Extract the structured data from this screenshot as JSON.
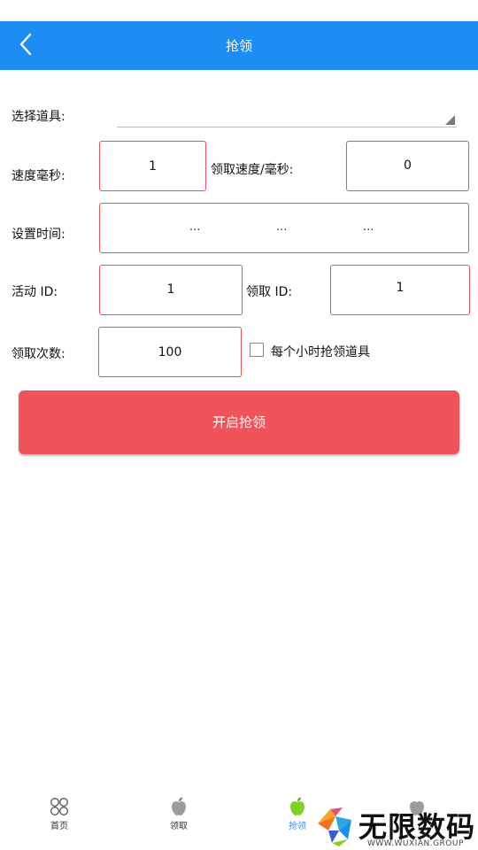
{
  "header": {
    "title": "抢领"
  },
  "form": {
    "select_item_label": "选择道具:",
    "speed_label": "速度毫秒:",
    "speed_value": "1",
    "claim_speed_label": "领取速度/毫秒:",
    "claim_speed_value": "0",
    "set_time_label": "设置时间:",
    "time_parts": [
      "...",
      "...",
      "..."
    ],
    "activity_id_label": "活动 ID:",
    "activity_id_value": "1",
    "claim_id_label": "领取 ID:",
    "claim_id_value": "1",
    "claim_count_label": "领取次数:",
    "claim_count_value": "100",
    "hourly_checkbox_label": "每个小时抢领道具",
    "hourly_checkbox_checked": false
  },
  "action": {
    "start_label": "开启抢领",
    "color": "#f0545a"
  },
  "tabs": [
    {
      "label": "首页",
      "icon": "grid-circles-icon",
      "active": false
    },
    {
      "label": "领取",
      "icon": "apple-gray-icon",
      "active": false
    },
    {
      "label": "抢领",
      "icon": "apple-green-icon",
      "active": true
    },
    {
      "label": "",
      "icon": "apple-gray-icon",
      "active": false
    }
  ],
  "watermark": {
    "brand": "无限数码",
    "sub": "WWW.WUXIAN.GROUP"
  },
  "colors": {
    "appbar": "#1e8cf5",
    "input_border": "#e9505a",
    "active_tab": "#2a8ff7"
  }
}
